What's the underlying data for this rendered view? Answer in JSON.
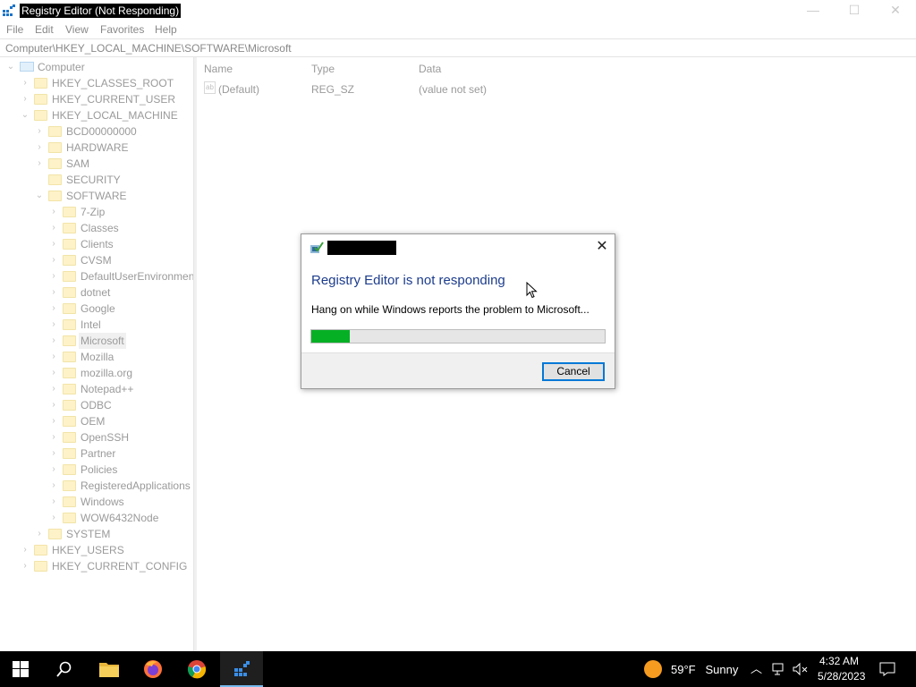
{
  "window": {
    "title": "Registry Editor (Not Responding)",
    "controls": {
      "minimize": "—",
      "maximize": "☐",
      "close": "✕"
    }
  },
  "menu": [
    "File",
    "Edit",
    "View",
    "Favorites",
    "Help"
  ],
  "address": "Computer\\HKEY_LOCAL_MACHINE\\SOFTWARE\\Microsoft",
  "tree": {
    "root": "Computer",
    "hives": [
      "HKEY_CLASSES_ROOT",
      "HKEY_CURRENT_USER",
      "HKEY_LOCAL_MACHINE"
    ],
    "hklm_children": [
      "BCD00000000",
      "HARDWARE",
      "SAM",
      "SECURITY",
      "SOFTWARE"
    ],
    "software_children": [
      "7-Zip",
      "Classes",
      "Clients",
      "CVSM",
      "DefaultUserEnvironmen",
      "dotnet",
      "Google",
      "Intel",
      "Microsoft",
      "Mozilla",
      "mozilla.org",
      "Notepad++",
      "ODBC",
      "OEM",
      "OpenSSH",
      "Partner",
      "Policies",
      "RegisteredApplications",
      "Windows",
      "WOW6432Node"
    ],
    "after_software": [
      "SYSTEM"
    ],
    "other_hives": [
      "HKEY_USERS",
      "HKEY_CURRENT_CONFIG"
    ],
    "selected": "Microsoft"
  },
  "list": {
    "headers": {
      "name": "Name",
      "type": "Type",
      "data": "Data"
    },
    "rows": [
      {
        "icon": "string-value-icon",
        "name": "(Default)",
        "type": "REG_SZ",
        "data": "(value not set)"
      }
    ]
  },
  "dialog": {
    "heading": "Registry Editor is not responding",
    "message": "Hang on while Windows reports the problem to Microsoft...",
    "progress_percent": 13,
    "cancel_label": "Cancel"
  },
  "taskbar": {
    "weather": {
      "temp": "59°F",
      "condition": "Sunny"
    },
    "time": "4:32 AM",
    "date": "5/28/2023"
  },
  "colors": {
    "progress": "#06b025",
    "heading": "#1c3c8c",
    "button_border": "#0078d7",
    "taskbar": "#000000"
  }
}
